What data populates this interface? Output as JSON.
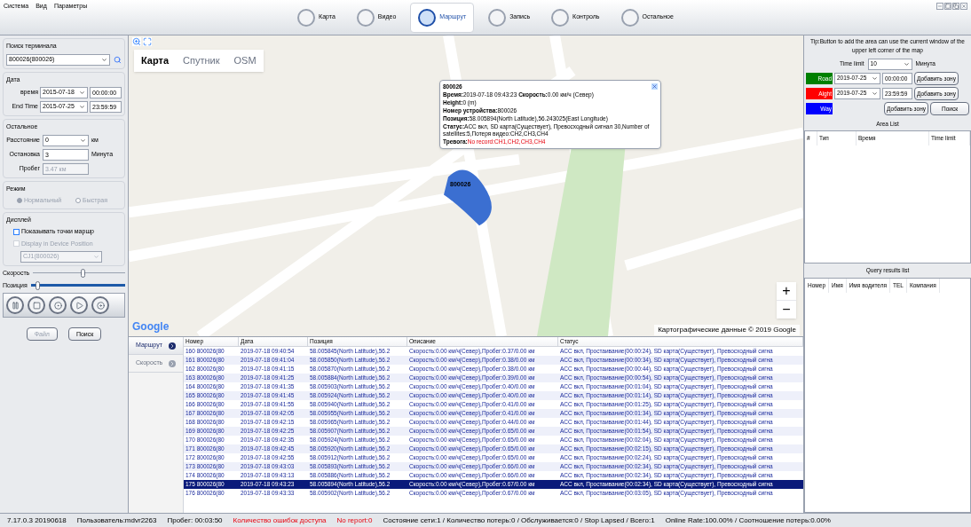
{
  "menu": [
    "Система",
    "Вид",
    "Параметры"
  ],
  "nav": [
    {
      "label": "Карта",
      "selected": false
    },
    {
      "label": "Видео",
      "selected": false
    },
    {
      "label": "Маршрут",
      "selected": true
    },
    {
      "label": "Запись",
      "selected": false
    },
    {
      "label": "Контроль",
      "selected": false
    },
    {
      "label": "Остальное",
      "selected": false
    }
  ],
  "left": {
    "terminal_label": "Поиск терминала",
    "terminal_value": "800026(800026)",
    "date_label": "Дата",
    "start_label": "время",
    "start_date": "2015-07-18",
    "start_time": "00:00:00",
    "end_label": "End Time",
    "end_date": "2015-07-25",
    "end_time": "23:59:59",
    "other_label": "Остальное",
    "distance_label": "Расстояние",
    "distance_value": "0",
    "distance_unit": "км",
    "stop_label": "Остановка",
    "stop_value": "3",
    "stop_unit": "Минута",
    "mileage_label": "Пробег",
    "mileage_value": "3.47 км",
    "mode_label": "Режим",
    "modes": [
      {
        "label": "Нормальный",
        "selected": true
      },
      {
        "label": "Быстрая",
        "selected": false
      }
    ],
    "display_label": "Дисплей",
    "options": [
      {
        "label": "Показывать точки маршр",
        "checked": false,
        "disabled": false
      },
      {
        "label": "Display in Device Position",
        "checked": false,
        "disabled": true
      }
    ],
    "device_value": "CJ1(800026)",
    "speed_label": "Скорость",
    "speed": {
      "level": 0.55
    },
    "position_label": "Позиция",
    "position": {
      "level": 0.08
    },
    "file_button": "Файл",
    "search_button": "Поиск"
  },
  "map": {
    "types": [
      {
        "label": "Карта",
        "selected": true
      },
      {
        "label": "Спутник",
        "selected": false
      },
      {
        "label": "OSM",
        "selected": false
      }
    ],
    "logo": "Google",
    "attribution": "Картографические данные © 2019 Google",
    "plus": "+",
    "minus": "−",
    "popup": {
      "title": "800026",
      "lines": [
        {
          "kind": "plain",
          "text": "**Время:**2019-07-18 09:43:23 **Скорость:**0.00 км/ч (Север)"
        },
        {
          "kind": "plain",
          "text": "**Height:**0 (m)"
        },
        {
          "kind": "plain",
          "text": "**Номер устройства:**800026"
        },
        {
          "kind": "plain",
          "text": "**Позиция:**58.005894(North Latitude),56.243025(East Longitude)"
        },
        {
          "kind": "plain",
          "text": "**Статус:**ACC вкл, SD карта(Существует), Превосходный сигнал 30,Number of satellites:5,Потеря видео:CH2,CH3,CH4"
        },
        {
          "kind": "alarm",
          "label": "Тревога:",
          "value": "No record:CH1,CH2,CH3,CH4"
        }
      ]
    },
    "marker_label": "800026"
  },
  "bottom_tabs": [
    {
      "label": "Маршрут",
      "selected": true
    },
    {
      "label": "Скорость",
      "selected": false
    }
  ],
  "table": {
    "columns": [
      "Номер",
      "Дата",
      "Позиция",
      "Описание",
      "Статус"
    ],
    "rows": [
      {
        "cells": [
          "160 800026(80",
          "2019-07-18 09:40:54",
          "58.005845(North Latitude),56.2",
          "Скорость:0.00 км/ч(Север),Пробег:0.37/0.00 км",
          "ACC вкл, Простаивание(00:00:24), SD карта(Существует), Превосходный сигна"
        ],
        "selected": false
      },
      {
        "cells": [
          "161 800026(80",
          "2019-07-18 09:41:04",
          "58.005850(North Latitude),56.2",
          "Скорость:0.00 км/ч(Север),Пробег:0.38/0.00 км",
          "ACC вкл, Простаивание(00:00:34), SD карта(Существует), Превосходный сигна"
        ],
        "selected": false
      },
      {
        "cells": [
          "162 800026(80",
          "2019-07-18 09:41:15",
          "58.005870(North Latitude),56.2",
          "Скорость:0.00 км/ч(Север),Пробег:0.38/0.00 км",
          "ACC вкл, Простаивание(00:00:44), SD карта(Существует), Превосходный сигна"
        ],
        "selected": false
      },
      {
        "cells": [
          "163 800026(80",
          "2019-07-18 09:41:25",
          "58.005884(North Latitude),56.2",
          "Скорость:0.00 км/ч(Север),Пробег:0.39/0.00 км",
          "ACC вкл, Простаивание(00:00:54), SD карта(Существует), Превосходный сигна"
        ],
        "selected": false
      },
      {
        "cells": [
          "164 800026(80",
          "2019-07-18 09:41:35",
          "58.005903(North Latitude),56.2",
          "Скорость:0.00 км/ч(Север),Пробег:0.40/0.00 км",
          "ACC вкл, Простаивание(00:01:04), SD карта(Существует), Превосходный сигна"
        ],
        "selected": false
      },
      {
        "cells": [
          "165 800026(80",
          "2019-07-18 09:41:45",
          "58.005924(North Latitude),56.2",
          "Скорость:0.00 км/ч(Север),Пробег:0.40/0.00 км",
          "ACC вкл, Простаивание(00:01:14), SD карта(Существует), Превосходный сигна"
        ],
        "selected": false
      },
      {
        "cells": [
          "166 800026(80",
          "2019-07-18 09:41:55",
          "58.005940(North Latitude),56.2",
          "Скорость:0.00 км/ч(Север),Пробег:0.41/0.00 км",
          "ACC вкл, Простаивание(00:01:25), SD карта(Существует), Превосходный сигна"
        ],
        "selected": false
      },
      {
        "cells": [
          "167 800026(80",
          "2019-07-18 09:42:05",
          "58.005955(North Latitude),56.2",
          "Скорость:0.00 км/ч(Север),Пробег:0.41/0.00 км",
          "ACC вкл, Простаивание(00:01:34), SD карта(Существует), Превосходный сигна"
        ],
        "selected": false
      },
      {
        "cells": [
          "168 800026(80",
          "2019-07-18 09:42:15",
          "58.005965(North Latitude),56.2",
          "Скорость:0.00 км/ч(Север),Пробег:0.44/0.00 км",
          "ACC вкл, Простаивание(00:01:44), SD карта(Существует), Превосходный сигна"
        ],
        "selected": false
      },
      {
        "cells": [
          "169 800026(80",
          "2019-07-18 09:42:25",
          "58.005907(North Latitude),56.2",
          "Скорость:0.00 км/ч(Север),Пробег:0.65/0.00 км",
          "ACC вкл, Простаивание(00:01:54), SD карта(Существует), Превосходный сигна"
        ],
        "selected": false
      },
      {
        "cells": [
          "170 800026(80",
          "2019-07-18 09:42:35",
          "58.005924(North Latitude),56.2",
          "Скорость:0.00 км/ч(Север),Пробег:0.65/0.00 км",
          "ACC вкл, Простаивание(00:02:04), SD карта(Существует), Превосходный сигна"
        ],
        "selected": false
      },
      {
        "cells": [
          "171 800026(80",
          "2019-07-18 09:42:45",
          "58.005920(North Latitude),56.2",
          "Скорость:0.00 км/ч(Север),Пробег:0.65/0.00 км",
          "ACC вкл, Простаивание(00:02:15), SD карта(Существует), Превосходный сигна"
        ],
        "selected": false
      },
      {
        "cells": [
          "172 800026(80",
          "2019-07-18 09:42:55",
          "58.005912(North Latitude),56.2",
          "Скорость:0.00 км/ч(Север),Пробег:0.65/0.00 км",
          "ACC вкл, Простаивание(00:02:24), SD карта(Существует), Превосходный сигна"
        ],
        "selected": false
      },
      {
        "cells": [
          "173 800026(80",
          "2019-07-18 09:43:03",
          "58.005893(North Latitude),56.2",
          "Скорость:0.00 км/ч(Север),Пробег:0.66/0.00 км",
          "ACC вкл, Простаивание(00:02:34), SD карта(Существует), Превосходный сигна"
        ],
        "selected": false
      },
      {
        "cells": [
          "174 800026(80",
          "2019-07-18 09:43:13",
          "58.005886(North Latitude),56.2",
          "Скорость:0.00 км/ч(Север),Пробег:0.66/0.00 км",
          "ACC вкл, Простаивание(00:02:34), SD карта(Существует), Превосходный сигна"
        ],
        "selected": false
      },
      {
        "cells": [
          "175 800026(80",
          "2019-07-18 09:43:23",
          "58.005894(North Latitude),56.2",
          "Скорость:0.00 км/ч(Север),Пробег:0.67/0.00 км",
          "ACC вкл, Простаивание(00:02:34), SD карта(Существует), Превосходный сигна"
        ],
        "selected": true
      },
      {
        "cells": [
          "176 800026(80",
          "2019-07-18 09:43:33",
          "58.005902(North Latitude),56.2",
          "Скорость:0.00 км/ч(Север),Пробег:0.67/0.00 км",
          "ACC вкл, Простаивание(00:03:05), SD карта(Существует), Превосходный сигна"
        ],
        "selected": false
      }
    ]
  },
  "right": {
    "tip": "Tip:Button to add the area can use the current window of the upper left corner of the map",
    "time_limit_label": "Time limit",
    "time_limit_value": "10",
    "time_limit_unit": "Минута",
    "zones": [
      {
        "label": "Road",
        "color": "#008000",
        "date": "2019-07-25",
        "time": "00:00:00",
        "button": "Добавить зону"
      },
      {
        "label": "Alght",
        "color": "#ff0000",
        "date": "2019-07-25",
        "time": "23:59:59",
        "button": "Добавить зону"
      },
      {
        "label": "Way",
        "color": "#0000ff"
      }
    ],
    "add_button": "Добавить зону",
    "search_button": "Поиск",
    "area_title": "Area List",
    "area_columns": [
      "#",
      "Тип",
      "Время",
      "Time limit"
    ],
    "query_title": "Query results list",
    "query_columns": [
      "Номер",
      "Имя",
      "Имя водителя",
      "TEL",
      "Компания"
    ]
  },
  "status_bar": [
    {
      "text": "7.17.0.3 20190618",
      "alert": false
    },
    {
      "text": "Пользователь:mdvr2263",
      "alert": false
    },
    {
      "text": "Пробег: 00:03:50",
      "alert": false
    },
    {
      "text": "Количество ошибок доступа",
      "alert": true
    },
    {
      "text": "No report:0",
      "alert": true
    },
    {
      "text": "Состояние сети:1 / Количество потерь:0 / Обслуживается:0 / Stop Lapsed / Всего:1",
      "alert": false
    },
    {
      "text": "Online Rate:100.00% / Соотношение потерь:0.00%",
      "alert": false
    }
  ]
}
